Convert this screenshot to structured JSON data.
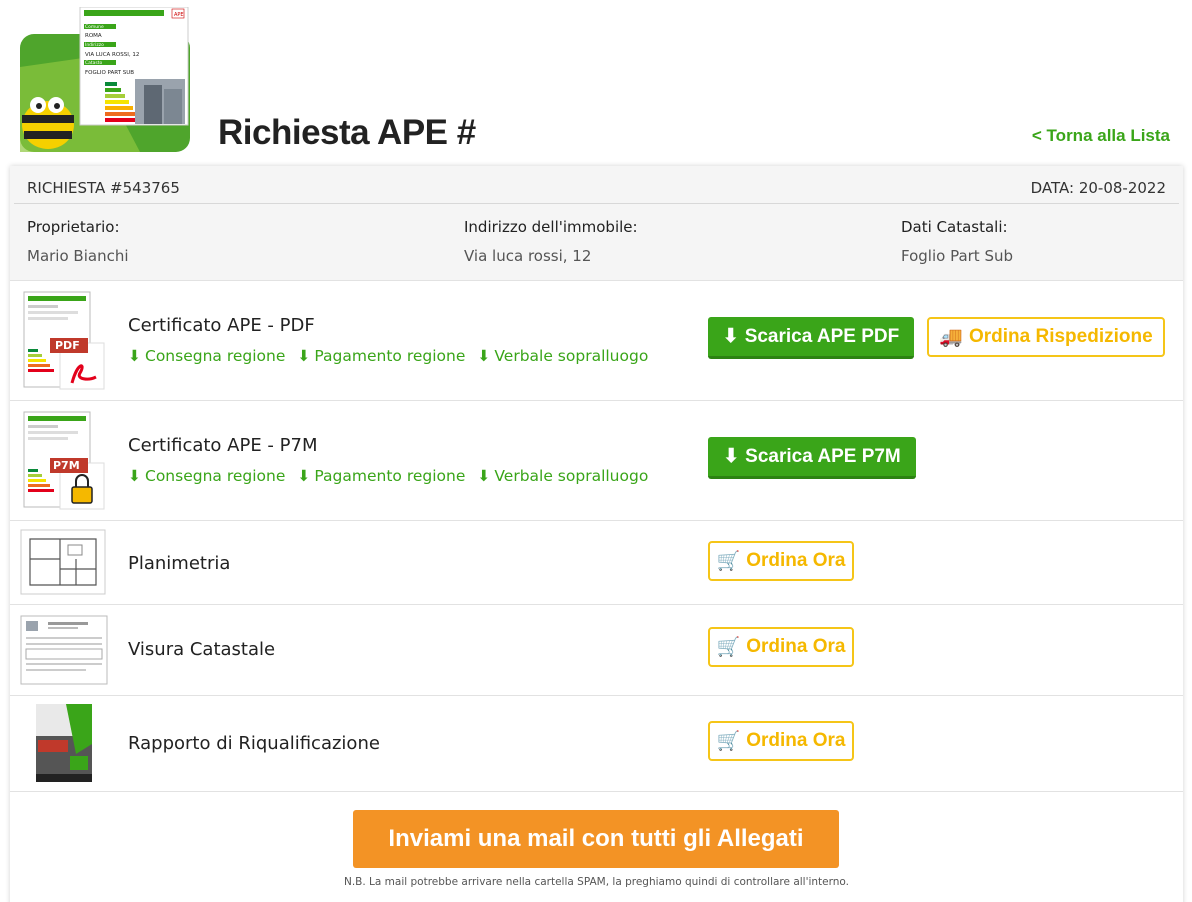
{
  "header": {
    "title": "Richiesta APE #",
    "back_link": "< Torna alla Lista",
    "logo": {
      "comune_label": "Comune",
      "comune": "ROMA",
      "indirizzo_label": "Indirizzo",
      "indirizzo": "VIA LUCA ROSSI, 12",
      "catasto_label": "Catasto",
      "catasto": "FOGLIO PART SUB",
      "badge": "APE"
    }
  },
  "request": {
    "number": "RICHIESTA #543765",
    "date": "DATA: 20-08-2022",
    "owner_label": "Proprietario:",
    "owner": "Mario Bianchi",
    "address_label": "Indirizzo dell'immobile:",
    "address": "Via luca rossi, 12",
    "cadastral_label": "Dati Catastali:",
    "cadastral": "Foglio Part Sub"
  },
  "items": [
    {
      "title": "Certificato APE - PDF",
      "thumb_tag": "PDF",
      "links": [
        "Consegna regione",
        "Pagamento regione",
        "Verbale sopralluogo"
      ],
      "primary_button": "Scarica APE PDF",
      "secondary_button": "Ordina Rispedizione"
    },
    {
      "title": "Certificato APE - P7M",
      "thumb_tag": "P7M",
      "links": [
        "Consegna regione",
        "Pagamento regione",
        "Verbale sopralluogo"
      ],
      "primary_button": "Scarica APE P7M"
    },
    {
      "title": "Planimetria",
      "order_button": "Ordina Ora"
    },
    {
      "title": "Visura Catastale",
      "order_button": "Ordina Ora"
    },
    {
      "title": "Rapporto di Riqualificazione",
      "order_button": "Ordina Ora"
    }
  ],
  "footer": {
    "mail_button": "Inviami una mail con tutti gli Allegati",
    "note": "N.B. La mail potrebbe arrivare nella cartella SPAM, la preghiamo quindi di controllare all'interno."
  },
  "colors": {
    "green": "#3aa519",
    "yellow": "#f5c518",
    "orange": "#f39325"
  }
}
